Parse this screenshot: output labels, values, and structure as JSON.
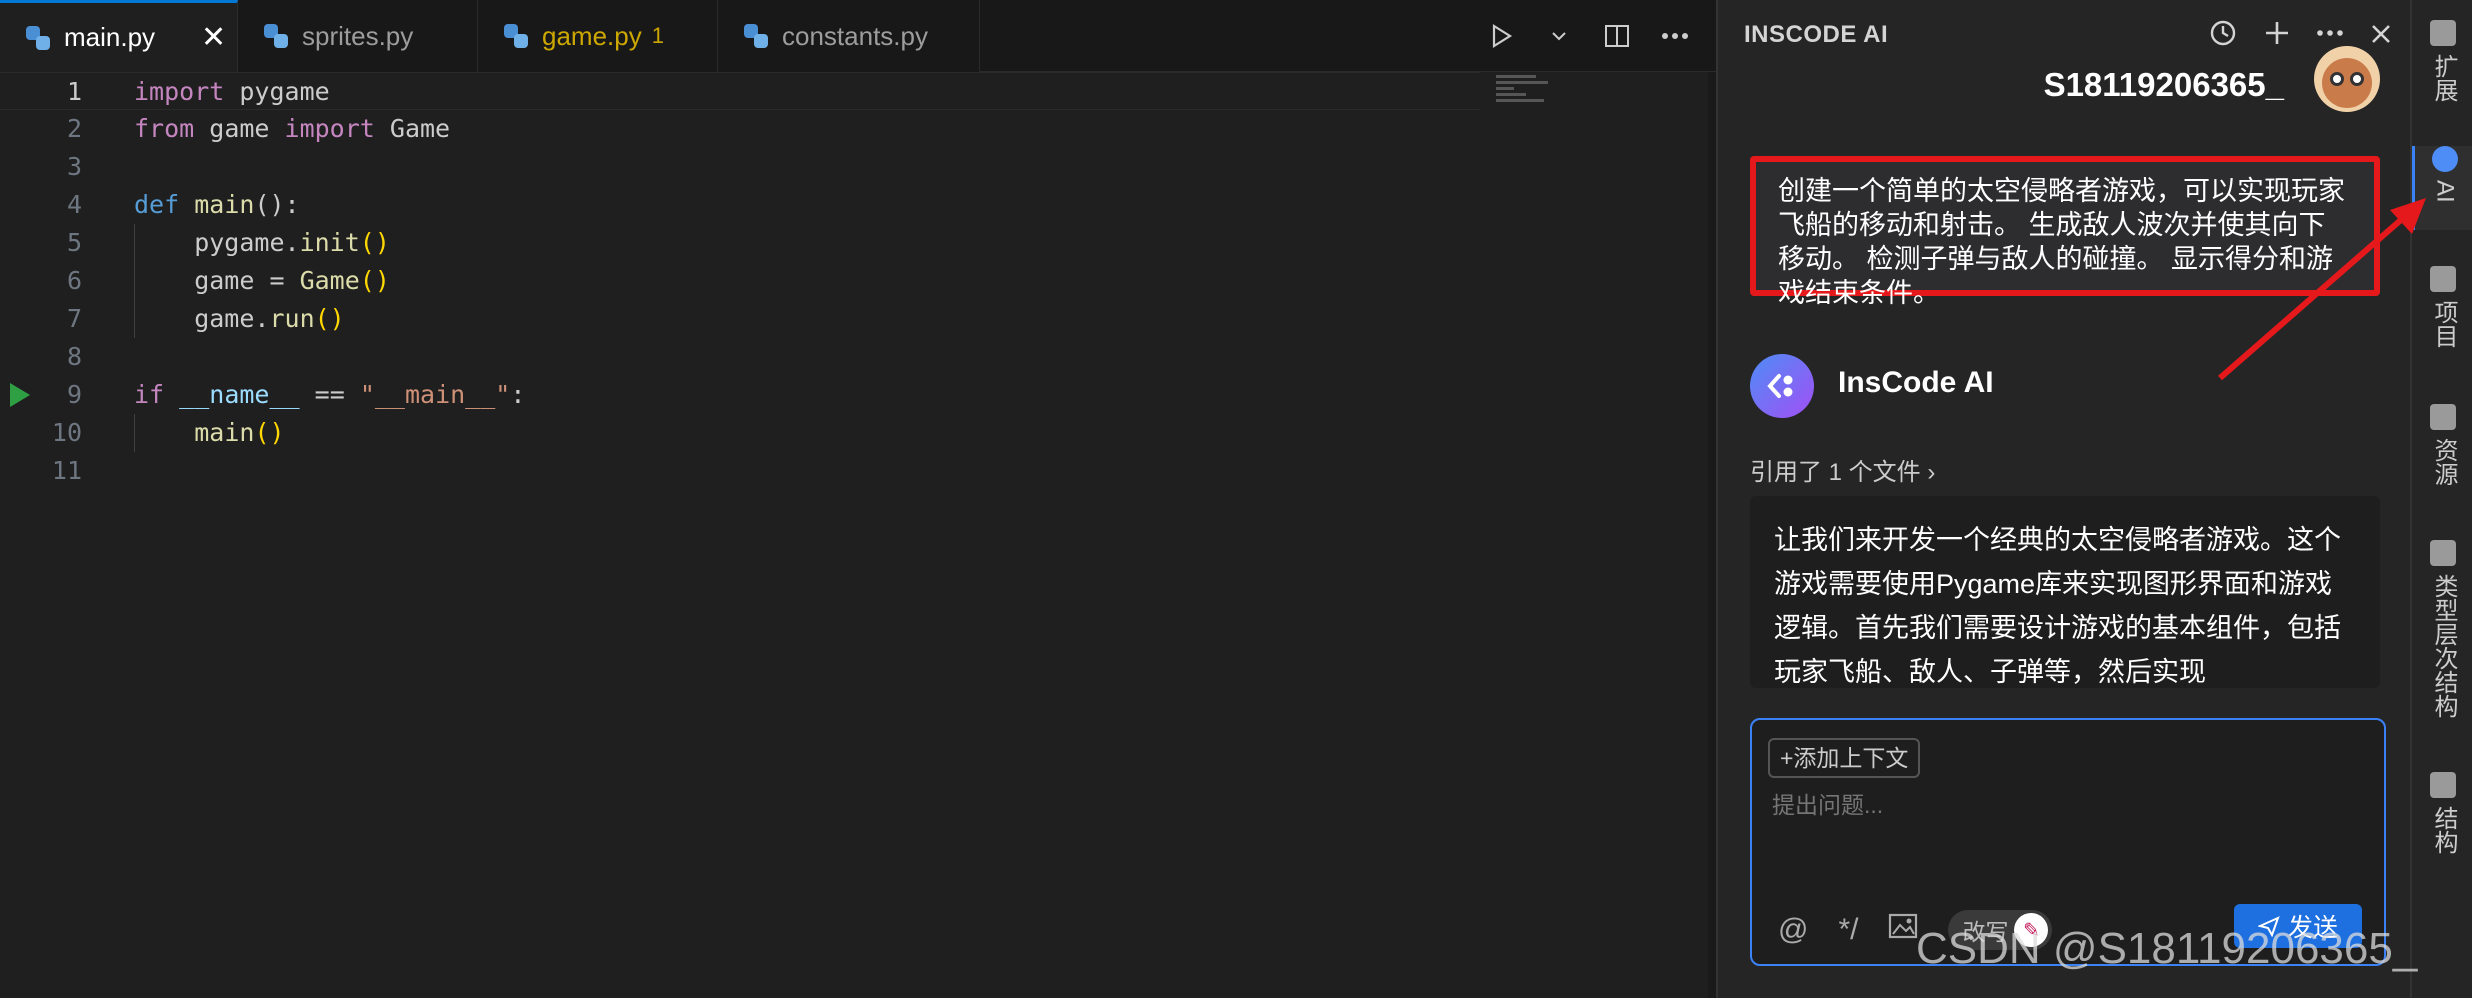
{
  "editor": {
    "tabs": [
      {
        "label": "main.py",
        "active": true,
        "close": "✕"
      },
      {
        "label": "sprites.py",
        "active": false
      },
      {
        "label": "game.py",
        "active": false,
        "badge": "1"
      },
      {
        "label": "constants.py",
        "active": false
      }
    ],
    "line_numbers": [
      "1",
      "2",
      "3",
      "4",
      "5",
      "6",
      "7",
      "8",
      "9",
      "10",
      "11"
    ],
    "code": {
      "l1": [
        "import",
        " pygame"
      ],
      "l2": [
        "from",
        " game ",
        "import",
        " Game"
      ],
      "l4": [
        "def",
        " ",
        "main",
        "():"
      ],
      "l5": [
        "    pygame.",
        "init",
        "()"
      ],
      "l6": [
        "    game = ",
        "Game",
        "()"
      ],
      "l7": [
        "    game.",
        "run",
        "()"
      ],
      "l9": [
        "if",
        " ",
        "__name__",
        " == ",
        "\"__main__\"",
        ":"
      ],
      "l10": [
        "    ",
        "main",
        "()"
      ]
    }
  },
  "panel": {
    "title": "INSCODE AI",
    "user_name": "S18119206365_",
    "user_message": "创建一个简单的太空侵略者游戏，可以实现玩家飞船的移动和射击。 生成敌人波次并使其向下移动。 检测子弹与敌人的碰撞。 显示得分和游戏结束条件。",
    "assistant_name": "InsCode AI",
    "citation": "引用了 1 个文件 ›",
    "assistant_message": "让我们来开发一个经典的太空侵略者游戏。这个游戏需要使用Pygame库来实现图形界面和游戏逻辑。首先我们需要设计游戏的基本组件，包括玩家飞船、敌人、子弹等，然后实现",
    "add_context": "+添加上下文",
    "input_placeholder": "提出问题...",
    "rewrite_label": "改写",
    "send_label": "发送"
  },
  "sidebar": {
    "items": [
      {
        "label": "扩展"
      },
      {
        "label": "AI"
      },
      {
        "label": "项目"
      },
      {
        "label": "资源"
      },
      {
        "label": "类型层次结构"
      },
      {
        "label": "结构"
      }
    ]
  },
  "watermark": "CSDN @S18119206365_",
  "colors": {
    "accent": "#0078d4",
    "highlight_box": "#e5191b",
    "send_button": "#1e6fe0"
  }
}
